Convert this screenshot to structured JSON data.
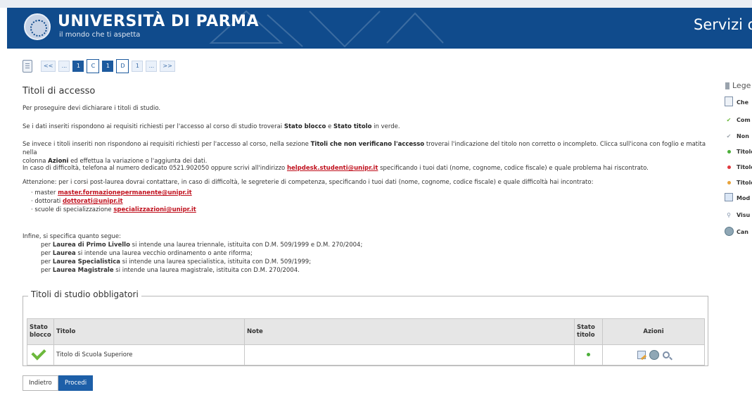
{
  "header": {
    "university": "UNIVERSITÀ DI PARMA",
    "motto": "il mondo che ti aspetta",
    "service_title": "Servizi on"
  },
  "wizard": {
    "steps": [
      "<<",
      "...",
      "1",
      "C",
      "1",
      "D",
      "1",
      "...",
      ">>"
    ]
  },
  "page": {
    "title": "Titoli di accesso",
    "intro": "Per proseguire devi dichiarare i titoli di studio."
  },
  "para2": {
    "t1": "Se i dati inseriti rispondono ai requisiti richiesti per l'accesso al corso di studio troverai ",
    "b1": "Stato blocco",
    "t2": " e ",
    "b2": "Stato titolo",
    "t3": " in verde."
  },
  "para3": {
    "t1": "Se invece i titoli inseriti non rispondono ai requisiti richiesti per l'accesso al corso, nella sezione ",
    "b1": "Titoli che non verificano l'accesso",
    "t2": " troverai l'indicazione del titolo non corretto o incompleto. Clicca sull'icona con foglio e matita nella",
    "t3": "colonna ",
    "b2": "Azioni",
    "t4": " ed effettua la variazione o l'aggiunta dei dati."
  },
  "para4": {
    "t1": "In caso di difficoltà, telefona al numero dedicato 0521.902050 oppure scrivi all'indirizzo ",
    "email": "helpdesk.studenti@unipr.it",
    "t2": " specificando i tuoi dati (nome, cognome, codice fiscale) e quale problema hai riscontrato."
  },
  "para5": "Attenzione: per i corsi post-laurea dovrai contattare, in caso di difficoltà, le segreterie di competenza, specificando i tuoi dati (nome, cognome, codice fiscale) e quale difficoltà hai incontrato:",
  "contacts": [
    {
      "label": "master ",
      "email": "master.formazionepermanente@unipr.it"
    },
    {
      "label": "dottorati ",
      "email": "dottorati@unipr.it"
    },
    {
      "label": "scuole di specializzazione ",
      "email": "specializzazioni@unipr.it"
    }
  ],
  "notes": {
    "intro": "Infine, si specifica quanto segue:",
    "lines": [
      {
        "pre": "per ",
        "b": "Laurea di Primo Livello",
        "post": " si intende una laurea triennale, istituita con D.M. 509/1999 e D.M. 270/2004;"
      },
      {
        "pre": "per ",
        "b": "Laurea",
        "post": " si intende una laurea vecchio ordinamento o ante riforma;"
      },
      {
        "pre": "per ",
        "b": "Laurea Specialistica",
        "post": " si intende una laurea specialistica, istituita con D.M. 509/1999;"
      },
      {
        "pre": "per ",
        "b": "Laurea Magistrale",
        "post": " si intende una laurea magistrale, istituita con D.M. 270/2004."
      }
    ]
  },
  "section": {
    "title": "Titoli di studio obbligatori",
    "columns": {
      "stato_blocco": "Stato blocco",
      "titolo": "Titolo",
      "note": "Note",
      "stato_titolo": "Stato titolo",
      "azioni": "Azioni"
    },
    "rows": [
      {
        "titolo": "Titolo di Scuola Superiore",
        "note": "",
        "status_color": "#4caf3a"
      }
    ]
  },
  "buttons": {
    "back": "Indietro",
    "next": "Procedi"
  },
  "legend": {
    "title": "Lege",
    "items": [
      {
        "label": "Che",
        "icon": "checklist-icon"
      },
      {
        "label": "Com",
        "icon": "green-check-icon"
      },
      {
        "label": "Non",
        "icon": "gray-check-icon"
      },
      {
        "label": "Titolo",
        "icon": "green-dot-icon",
        "color": "#4caf3a"
      },
      {
        "label": "Titolo",
        "icon": "red-dot-icon",
        "color": "#e0393e"
      },
      {
        "label": "Titolo",
        "icon": "orange-dot-icon",
        "color": "#e8a33a"
      },
      {
        "label": "Mod",
        "icon": "edit-icon"
      },
      {
        "label": "Visu",
        "icon": "magnifier-icon"
      },
      {
        "label": "Can",
        "icon": "globe-icon"
      }
    ]
  }
}
